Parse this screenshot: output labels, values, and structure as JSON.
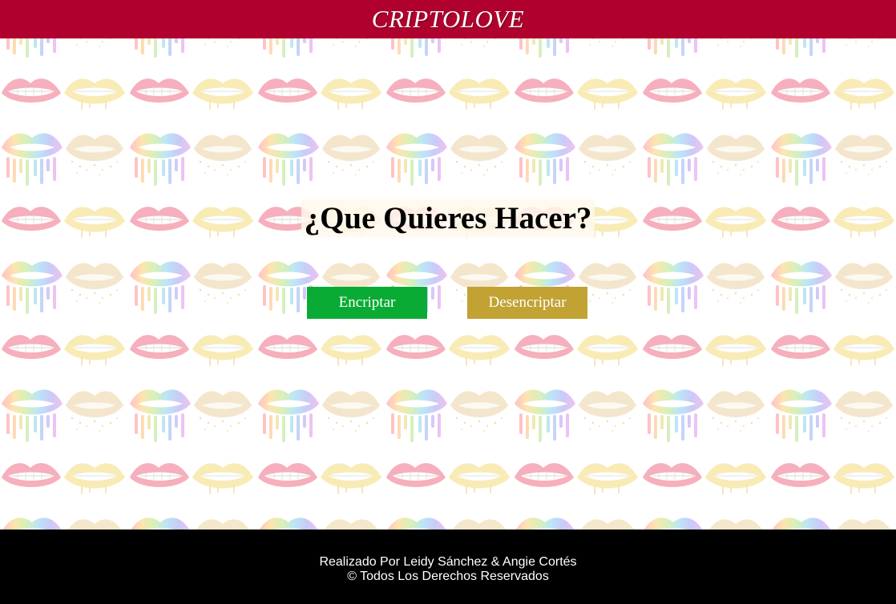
{
  "header": {
    "brand": "CRIPTOLOVE",
    "background": "#b0002e"
  },
  "main": {
    "background_pattern": "lips-pattern",
    "question": "¿Que Quieres Hacer?",
    "buttons": {
      "encrypt_label": "Encriptar",
      "encrypt_color": "#0aab34",
      "decrypt_label": "Desencriptar",
      "decrypt_color": "#c1a233"
    }
  },
  "footer": {
    "credit": "Realizado Por Leidy Sánchez & Angie Cortés",
    "rights": "© Todos Los Derechos Reservados",
    "background": "#000000"
  }
}
